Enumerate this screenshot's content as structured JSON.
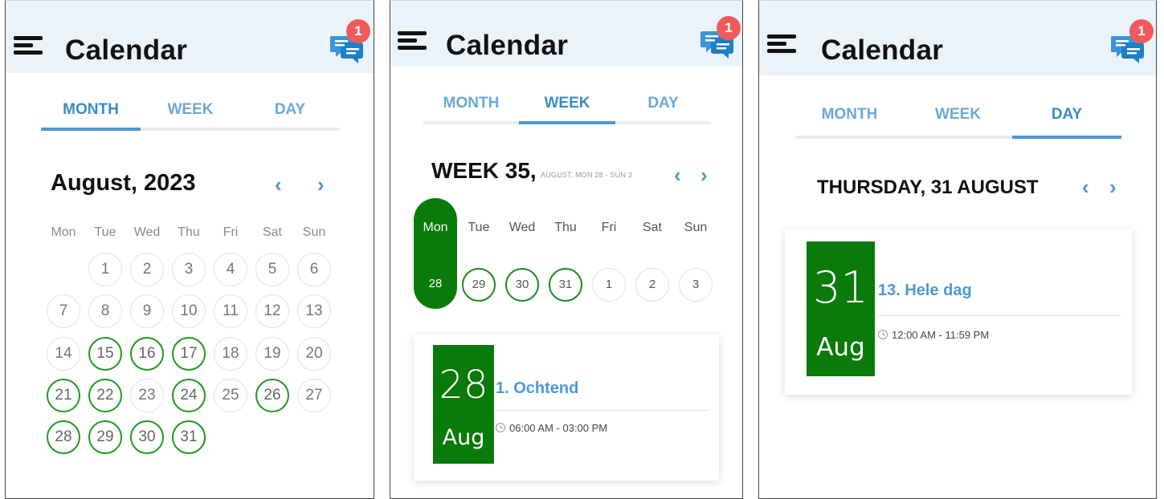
{
  "app": {
    "title": "Calendar",
    "notification_count": "1",
    "accent_color": "#4a9ad4",
    "event_color": "#0a7a0a",
    "badge_color": "#f25a5a"
  },
  "tabs": [
    "MONTH",
    "WEEK",
    "DAY"
  ],
  "month_view": {
    "active_tab": "MONTH",
    "title": "August, 2023",
    "prev_arrow": "‹",
    "next_arrow": "›",
    "weekdays": [
      "Mon",
      "Tue",
      "Wed",
      "Thu",
      "Fri",
      "Sat",
      "Sun"
    ],
    "days": [
      {
        "label": "1",
        "event": false
      },
      {
        "label": "2",
        "event": false
      },
      {
        "label": "3",
        "event": false
      },
      {
        "label": "4",
        "event": false
      },
      {
        "label": "5",
        "event": false
      },
      {
        "label": "6",
        "event": false
      },
      {
        "label": "7",
        "event": false
      },
      {
        "label": "8",
        "event": false
      },
      {
        "label": "9",
        "event": false
      },
      {
        "label": "10",
        "event": false
      },
      {
        "label": "11",
        "event": false
      },
      {
        "label": "12",
        "event": false
      },
      {
        "label": "13",
        "event": false
      },
      {
        "label": "14",
        "event": false
      },
      {
        "label": "15",
        "event": true
      },
      {
        "label": "16",
        "event": true
      },
      {
        "label": "17",
        "event": true
      },
      {
        "label": "18",
        "event": false
      },
      {
        "label": "19",
        "event": false
      },
      {
        "label": "20",
        "event": false
      },
      {
        "label": "21",
        "event": true
      },
      {
        "label": "22",
        "event": true
      },
      {
        "label": "23",
        "event": false
      },
      {
        "label": "24",
        "event": true
      },
      {
        "label": "25",
        "event": false
      },
      {
        "label": "26",
        "event": true
      },
      {
        "label": "27",
        "event": false
      },
      {
        "label": "28",
        "event": true
      },
      {
        "label": "29",
        "event": true
      },
      {
        "label": "30",
        "event": true
      },
      {
        "label": "31",
        "event": true
      }
    ]
  },
  "week_view": {
    "active_tab": "WEEK",
    "title": "WEEK 35,",
    "subtitle": "AUGUST, MON 28 - SUN 3",
    "prev_arrow": "‹",
    "next_arrow": "›",
    "weekdays": [
      "Mon",
      "Tue",
      "Wed",
      "Thu",
      "Fri",
      "Sat",
      "Sun"
    ],
    "days": [
      {
        "label": "28",
        "event": true,
        "selected": true
      },
      {
        "label": "29",
        "event": true,
        "selected": false
      },
      {
        "label": "30",
        "event": true,
        "selected": false
      },
      {
        "label": "31",
        "event": true,
        "selected": false
      },
      {
        "label": "1",
        "event": false,
        "selected": false
      },
      {
        "label": "2",
        "event": false,
        "selected": false
      },
      {
        "label": "3",
        "event": false,
        "selected": false
      }
    ],
    "event": {
      "day": "28",
      "month": "Aug",
      "title": "1. Ochtend",
      "time": "06:00 AM - 03:00 PM"
    }
  },
  "day_view": {
    "active_tab": "DAY",
    "title": "THURSDAY, 31 AUGUST",
    "prev_arrow": "‹",
    "next_arrow": "›",
    "event": {
      "day": "31",
      "month": "Aug",
      "title": "13. Hele dag",
      "time": "12:00 AM - 11:59 PM"
    }
  }
}
